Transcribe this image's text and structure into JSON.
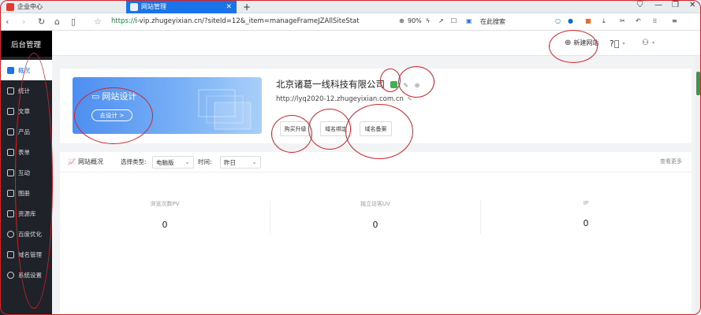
{
  "browser": {
    "tabs": [
      {
        "label": "企业中心",
        "active": false
      },
      {
        "label": "网站管理",
        "active": true
      }
    ],
    "address": {
      "scheme": "https://",
      "rest": "i-vip.zhugeyixian.cn/?siteId=12&_item=manageFrameJZAllSiteStat"
    },
    "zoom": "90%",
    "search_label": "在此搜索"
  },
  "app": {
    "brand": "后台管理",
    "menu": [
      "概况",
      "统计",
      "文章",
      "产品",
      "表单",
      "互动",
      "图册",
      "资源库",
      "百度优化",
      "域名管理",
      "系统设置"
    ],
    "top": {
      "new_site": "新建网站"
    }
  },
  "site": {
    "banner_title": "网站设计",
    "banner_button": "去设计 >",
    "name": "北京诸葛一线科技有限公司",
    "url": "http://lyq2020-12.zhugeyixian.com.cn",
    "buttons": [
      "购买升级",
      "域名绑定",
      "域名备案"
    ]
  },
  "stats": {
    "title": "网站概况",
    "type_label": "选择类型:",
    "type_value": "电脑版",
    "time_label": "时间:",
    "time_value": "昨日",
    "more": "查看更多",
    "metrics": [
      {
        "label": "浏览次数PV",
        "value": "0"
      },
      {
        "label": "独立访客UV",
        "value": "0"
      },
      {
        "label": "IP",
        "value": "0"
      }
    ]
  },
  "colors": {
    "accent": "#1a73e8",
    "annotation": "#d0232a",
    "sidebar": "#1f2329"
  }
}
